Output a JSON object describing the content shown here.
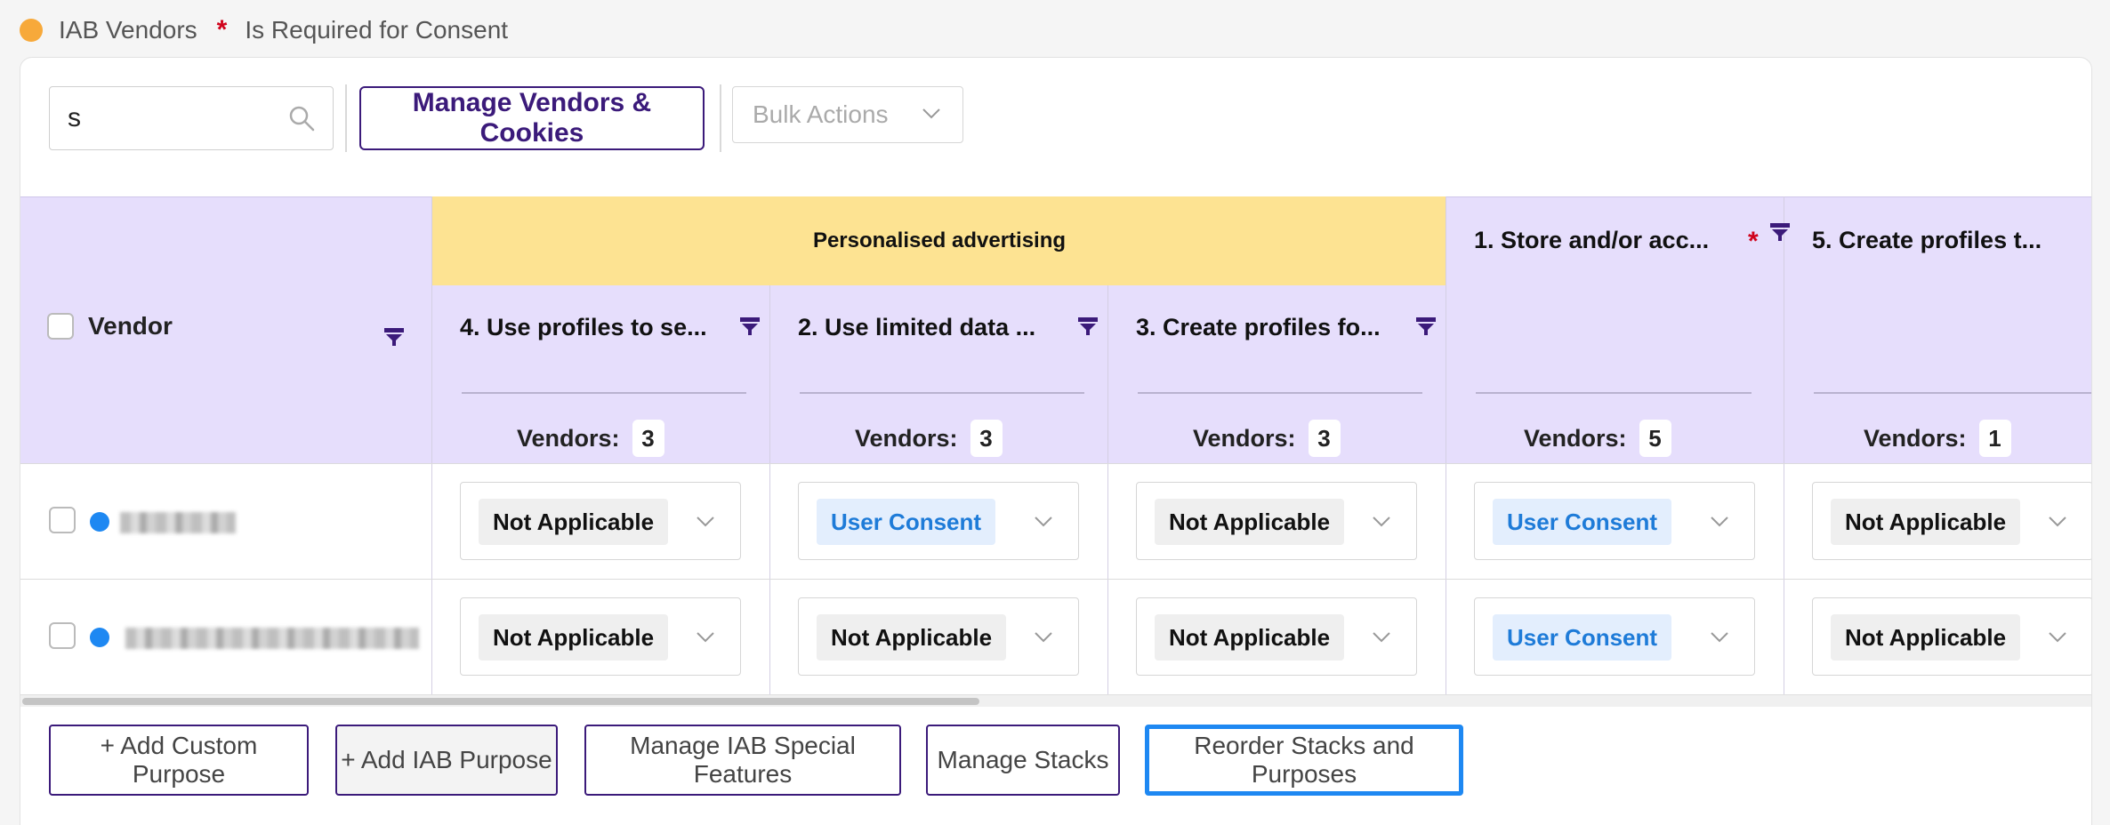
{
  "legend": {
    "iab_label": "IAB Vendors",
    "required_star": "*",
    "required_label": "Is Required for Consent",
    "iab_color": "#f7a93a"
  },
  "toolbar": {
    "search_value": "s",
    "manage_label": "Manage Vendors & Cookies",
    "bulk_label": "Bulk Actions"
  },
  "table": {
    "vendor_header": "Vendor",
    "group_header": "Personalised advertising",
    "vendors_label": "Vendors:",
    "columns": [
      {
        "title": "4. Use profiles to se...",
        "count": "3"
      },
      {
        "title": "2. Use limited data ...",
        "count": "3"
      },
      {
        "title": "3. Create profiles fo...",
        "count": "3"
      },
      {
        "title": "1. Store and/or acc...",
        "count": "5",
        "required_star": "*"
      },
      {
        "title": "5. Create profiles t...",
        "count": "1"
      }
    ],
    "rows": [
      {
        "cells": [
          "Not Applicable",
          "User Consent",
          "Not Applicable",
          "User Consent",
          "Not Applicable"
        ]
      },
      {
        "cells": [
          "Not Applicable",
          "Not Applicable",
          "Not Applicable",
          "User Consent",
          "Not Applicable"
        ]
      }
    ]
  },
  "actions": {
    "add_custom": "+ Add Custom Purpose",
    "add_iab": "+ Add IAB Purpose",
    "special_features": "Manage IAB Special Features",
    "stacks": "Manage Stacks",
    "reorder": "Reorder Stacks and Purposes"
  },
  "colors": {
    "accent": "#3b1a7a",
    "header_bg": "#e6defc",
    "group_bg": "#fde392",
    "consent_text": "#1e7bd8",
    "focus": "#1e88f2"
  }
}
